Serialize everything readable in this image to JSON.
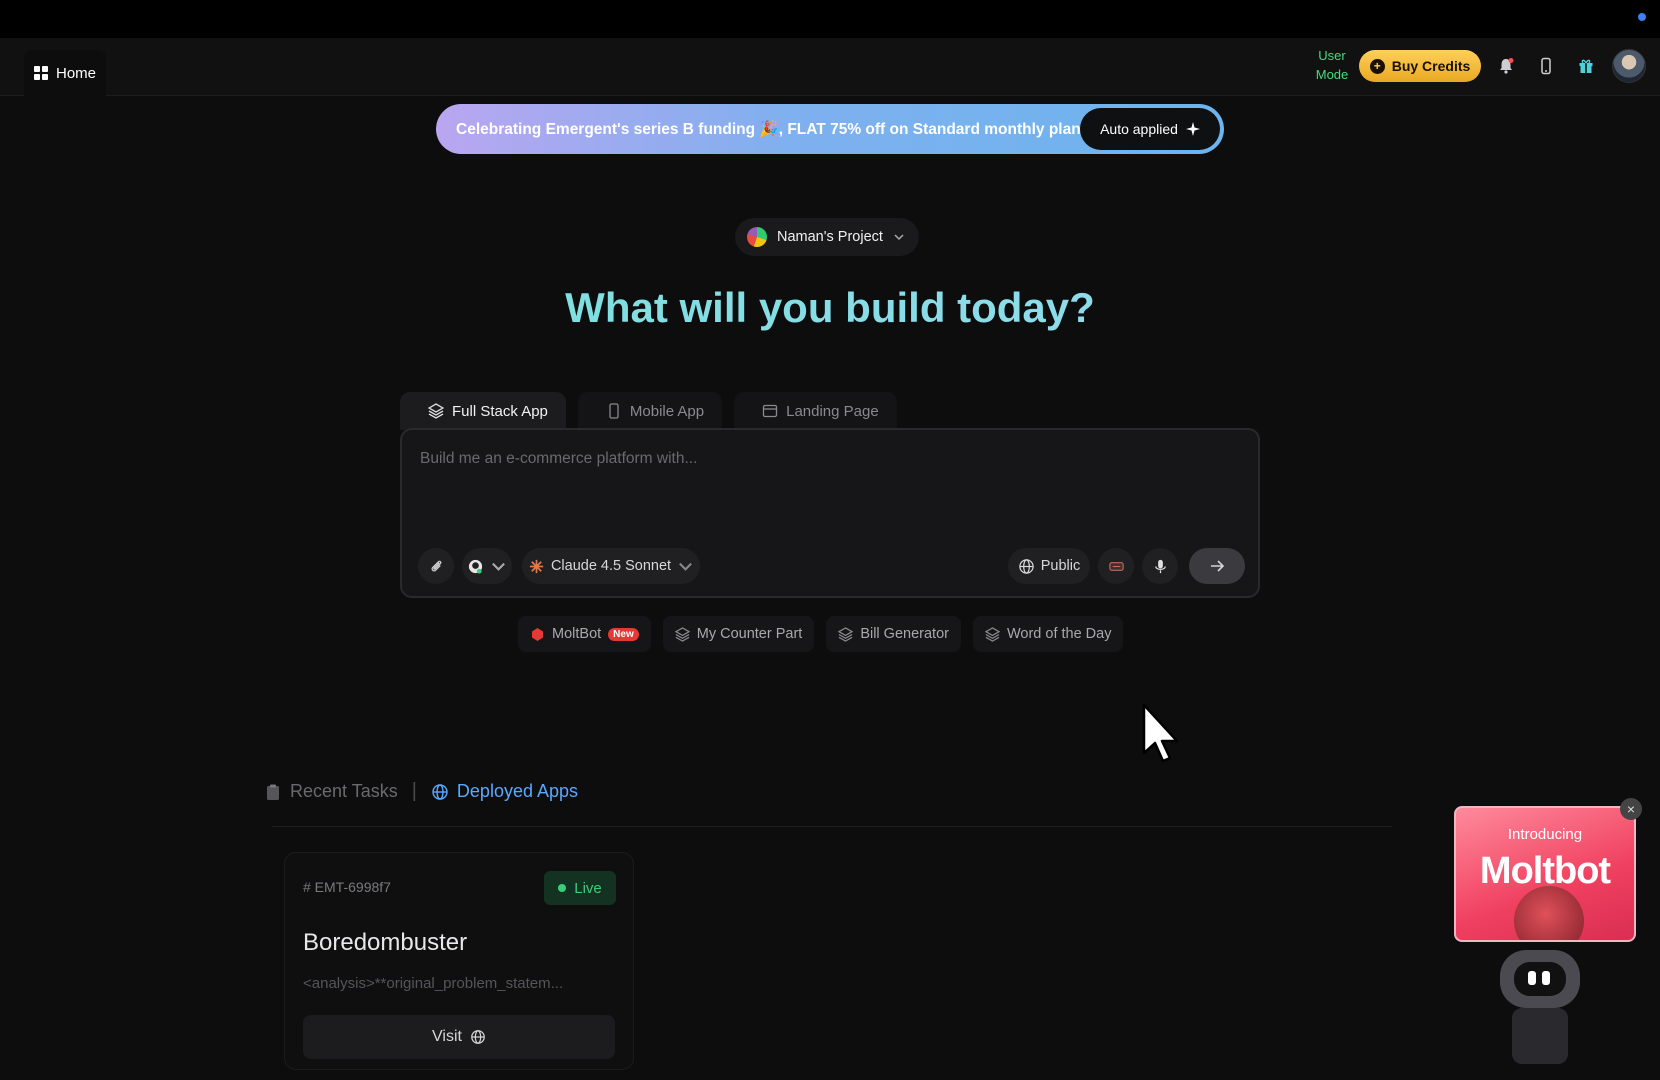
{
  "header": {
    "home_label": "Home",
    "user_mode": "User Mode",
    "buy_credits": "Buy Credits"
  },
  "banner": {
    "text": "Celebrating Emergent's series B funding 🎉, FLAT 75% off on Standard monthly plan.",
    "button": "Auto applied"
  },
  "project": {
    "name": "Naman's Project"
  },
  "headline": "What will you build today?",
  "tabs": [
    {
      "label": "Full Stack App",
      "icon": "layers-icon",
      "active": true
    },
    {
      "label": "Mobile App",
      "icon": "phone-icon",
      "active": false
    },
    {
      "label": "Landing Page",
      "icon": "window-icon",
      "active": false
    }
  ],
  "composer": {
    "placeholder": "Build me an e-commerce platform with...",
    "model": "Claude 4.5 Sonnet",
    "visibility": "Public"
  },
  "chips": [
    {
      "label": "MoltBot",
      "badge": "New"
    },
    {
      "label": "My Counter Part"
    },
    {
      "label": "Bill Generator"
    },
    {
      "label": "Word of the Day"
    }
  ],
  "sections": {
    "recent": "Recent Tasks",
    "deployed": "Deployed Apps",
    "active": "deployed"
  },
  "card": {
    "id": "# EMT-6998f7",
    "status": "Live",
    "title": "Boredombuster",
    "description": "<analysis>**original_problem_statem...",
    "visit": "Visit"
  },
  "promo": {
    "intro": "Introducing",
    "title": "Moltbot"
  },
  "colors": {
    "accent_green": "#36d07a",
    "accent_blue": "#5aa8ff",
    "credits_gold": "#ffd05a"
  }
}
